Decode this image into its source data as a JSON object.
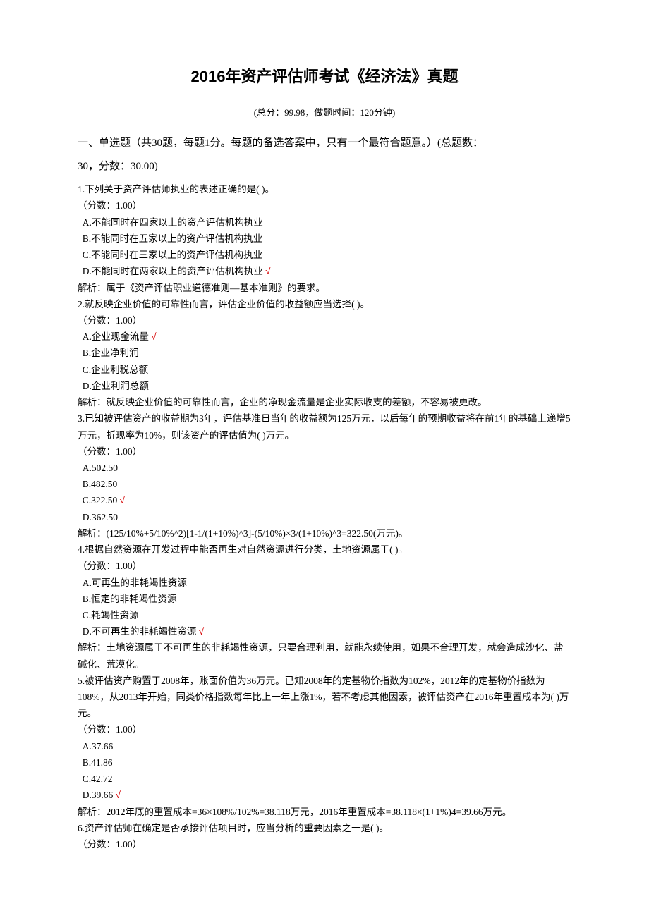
{
  "title": "2016年资产评估师考试《经济法》真题",
  "subtitle": "(总分：99.98，做题时间：120分钟)",
  "section1_header_line1": "一、单选题（共30题，每题1分。每题的备选答案中，只有一个最符合题意。）(总题数：",
  "section1_header_line2": "30，分数：30.00)",
  "q1": {
    "text": "1.下列关于资产评估师执业的表述正确的是( )。",
    "points": "（分数：1.00）",
    "A": " A.不能同时在四家以上的资产评估机构执业",
    "B": " B.不能同时在五家以上的资产评估机构执业",
    "C": " C.不能同时在三家以上的资产评估机构执业",
    "D": " D.不能同时在两家以上的资产评估机构执业 ",
    "analysis": "解析：属于《资产评估职业道德准则—基本准则》的要求。"
  },
  "q2": {
    "text": "2.就反映企业价值的可靠性而言，评估企业价值的收益额应当选择( )。",
    "points": "（分数：1.00）",
    "A": " A.企业现金流量 ",
    "B": " B.企业净利润",
    "C": " C.企业利税总额",
    "D": " D.企业利润总额",
    "analysis": "解析：就反映企业价值的可靠性而言，企业的净现金流量是企业实际收支的差额，不容易被更改。"
  },
  "q3": {
    "text": "3.已知被评估资产的收益期为3年，评估基准日当年的收益额为125万元，以后每年的预期收益将在前1年的基础上递增5万元，折现率为10%，则该资产的评估值为( )万元。",
    "points": "（分数：1.00）",
    "A": " A.502.50",
    "B": " B.482.50",
    "C": " C.322.50 ",
    "D": " D.362.50",
    "analysis": "解析：(125/10%+5/10%^2)[1-1/(1+10%)^3]-(5/10%)×3/(1+10%)^3=322.50(万元)。"
  },
  "q4": {
    "text": "4.根据自然资源在开发过程中能否再生对自然资源进行分类，土地资源属于( )。",
    "points": "（分数：1.00）",
    "A": " A.可再生的非耗竭性资源",
    "B": " B.恒定的非耗竭性资源",
    "C": " C.耗竭性资源",
    "D": " D.不可再生的非耗竭性资源 ",
    "analysis": "解析：土地资源属于不可再生的非耗竭性资源，只要合理利用，就能永续使用，如果不合理开发，就会造成沙化、盐碱化、荒漠化。"
  },
  "q5": {
    "text": "5.被评估资产购置于2008年，账面价值为36万元。已知2008年的定基物价指数为102%，2012年的定基物价指数为108%，从2013年开始，同类价格指数每年比上一年上涨1%，若不考虑其他因素，被评估资产在2016年重置成本为( )万元。",
    "points": "（分数：1.00）",
    "A": " A.37.66",
    "B": " B.41.86",
    "C": " C.42.72",
    "D": " D.39.66 ",
    "analysis": "解析：2012年底的重置成本=36×108%/102%=38.118万元，2016年重置成本=38.118×(1+1%)4=39.66万元。"
  },
  "q6": {
    "text": "6.资产评估师在确定是否承接评估项目时，应当分析的重要因素之一是( )。",
    "points": "（分数：1.00）"
  },
  "check_mark": " √"
}
